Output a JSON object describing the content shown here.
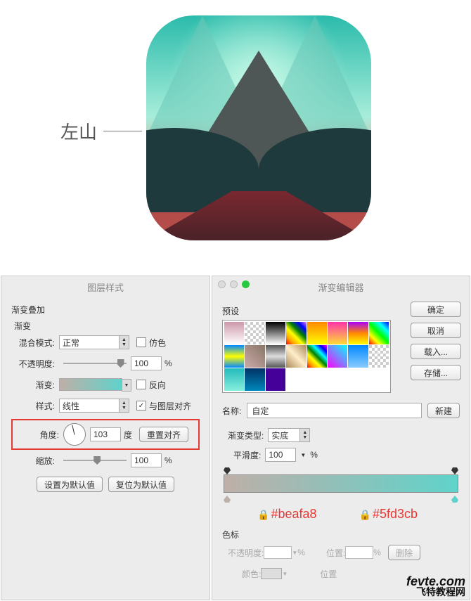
{
  "annotation": {
    "left_mountain": "左山"
  },
  "layer_style": {
    "title": "图层样式",
    "section": "渐变叠加",
    "subsection": "渐变",
    "blend_mode_label": "混合模式:",
    "blend_mode_value": "正常",
    "dither_label": "仿色",
    "dither_checked": false,
    "opacity_label": "不透明度:",
    "opacity_value": "100",
    "opacity_unit": "%",
    "gradient_label": "渐变:",
    "reverse_label": "反向",
    "reverse_checked": false,
    "style_label": "样式:",
    "style_value": "线性",
    "align_label": "与图层对齐",
    "align_checked": true,
    "angle_label": "角度:",
    "angle_value": "103",
    "angle_unit": "度",
    "reset_align_btn": "重置对齐",
    "scale_label": "缩放:",
    "scale_value": "100",
    "scale_unit": "%",
    "set_default_btn": "设置为默认值",
    "reset_default_btn": "复位为默认值"
  },
  "gradient_editor": {
    "title": "渐变编辑器",
    "presets_label": "预设",
    "ok_btn": "确定",
    "cancel_btn": "取消",
    "load_btn": "载入...",
    "save_btn": "存储...",
    "name_label": "名称:",
    "name_value": "自定",
    "new_btn": "新建",
    "type_label": "渐变类型:",
    "type_value": "实底",
    "smooth_label": "平滑度:",
    "smooth_value": "100",
    "smooth_unit": "%",
    "hex_left": "#beafa8",
    "hex_right": "#5fd3cb",
    "stops_header": "色标",
    "stop_opacity_label": "不透明度:",
    "stop_opacity_unit": "%",
    "stop_pos_label": "位置:",
    "stop_pos_unit": "%",
    "delete_btn": "删除",
    "stop_color_label": "颜色:",
    "stop_pos2_label": "位置"
  },
  "watermark": {
    "domain": "fevte.com",
    "cn": "飞特教程网"
  }
}
